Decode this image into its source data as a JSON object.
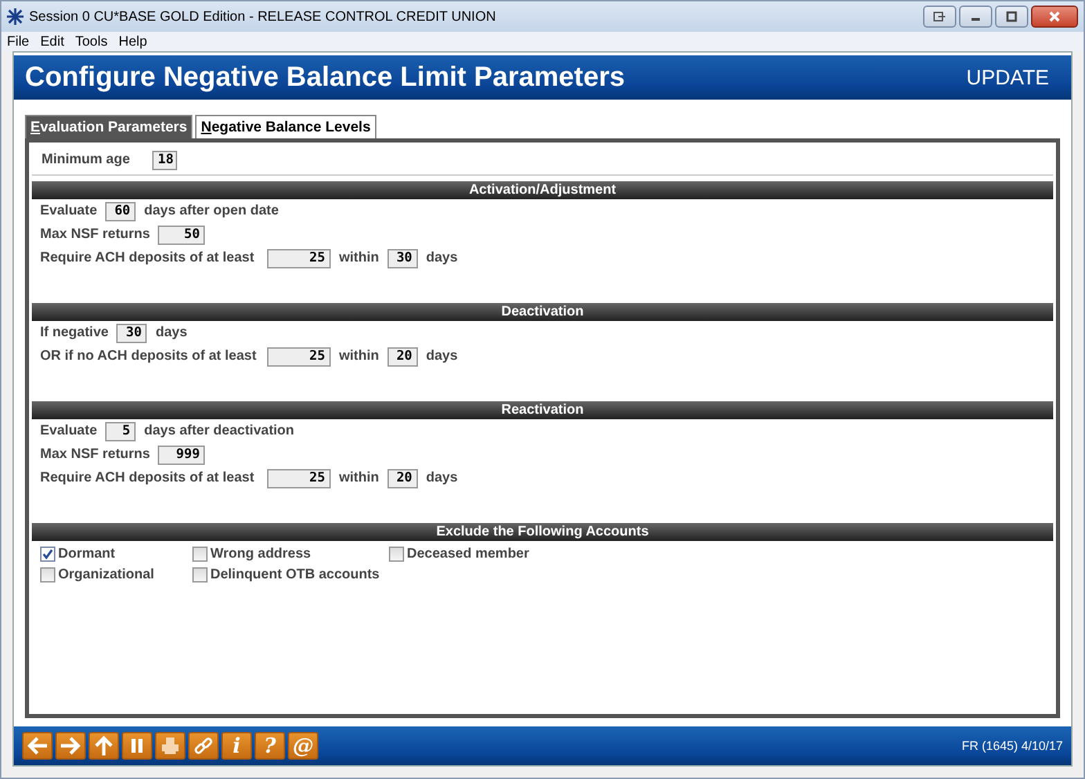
{
  "window": {
    "title": "Session 0 CU*BASE GOLD Edition - RELEASE CONTROL CREDIT UNION"
  },
  "menu": [
    "File",
    "Edit",
    "Tools",
    "Help"
  ],
  "header": {
    "title": "Configure Negative Balance Limit Parameters",
    "mode": "UPDATE"
  },
  "tabs": [
    {
      "label": "Evaluation Parameters",
      "selected": true
    },
    {
      "label": "Negative Balance Levels",
      "selected": false
    }
  ],
  "minimum_age": {
    "label": "Minimum age",
    "value": "18"
  },
  "sections": [
    {
      "title": "Activation/Adjustment",
      "rows": [
        {
          "parts": [
            {
              "kind": "text",
              "text": "Evaluate"
            },
            {
              "kind": "short_field",
              "value": "60"
            },
            {
              "kind": "text",
              "text": "days after open date"
            }
          ]
        },
        {
          "parts": [
            {
              "kind": "text",
              "text": "Max NSF returns"
            },
            {
              "kind": "mid_field",
              "value": "50"
            }
          ]
        },
        {
          "parts": [
            {
              "kind": "label",
              "text": "Require ACH deposits of at least"
            },
            {
              "kind": "long_field",
              "value": "25"
            },
            {
              "kind": "text",
              "text": "within"
            },
            {
              "kind": "short_field",
              "value": "30"
            },
            {
              "kind": "text",
              "text": "days"
            }
          ]
        }
      ]
    },
    {
      "title": "Deactivation",
      "rows": [
        {
          "parts": [
            {
              "kind": "text",
              "text": "If negative"
            },
            {
              "kind": "short_field",
              "value": "30"
            },
            {
              "kind": "text",
              "text": "days"
            }
          ]
        },
        {
          "parts": [
            {
              "kind": "label",
              "text": "OR if no ACH deposits of at least"
            },
            {
              "kind": "long_field",
              "value": "25"
            },
            {
              "kind": "text",
              "text": "within"
            },
            {
              "kind": "short_field",
              "value": "20"
            },
            {
              "kind": "text",
              "text": "days"
            }
          ]
        }
      ]
    },
    {
      "title": "Reactivation",
      "rows": [
        {
          "parts": [
            {
              "kind": "text",
              "text": "Evaluate"
            },
            {
              "kind": "short_field",
              "value": "5"
            },
            {
              "kind": "text",
              "text": "days after deactivation"
            }
          ]
        },
        {
          "parts": [
            {
              "kind": "text",
              "text": "Max NSF returns"
            },
            {
              "kind": "mid_field",
              "value": "999"
            }
          ]
        },
        {
          "parts": [
            {
              "kind": "label",
              "text": "Require ACH deposits of at least"
            },
            {
              "kind": "long_field",
              "value": "25"
            },
            {
              "kind": "text",
              "text": "within"
            },
            {
              "kind": "short_field",
              "value": "20"
            },
            {
              "kind": "text",
              "text": "days"
            }
          ]
        }
      ]
    }
  ],
  "exclusions": {
    "title": "Exclude the Following Accounts",
    "items": [
      {
        "label": "Dormant",
        "checked": true
      },
      {
        "label": "Wrong address",
        "checked": false
      },
      {
        "label": "Deceased member",
        "checked": false
      },
      {
        "label": "Organizational",
        "checked": false
      },
      {
        "label": "Delinquent OTB accounts",
        "checked": false
      }
    ]
  },
  "toolbar": [
    {
      "kind": "back"
    },
    {
      "kind": "forward"
    },
    {
      "kind": "up"
    },
    {
      "kind": "pause"
    },
    {
      "kind": "print"
    },
    {
      "kind": "link"
    },
    {
      "kind": "glyph",
      "text": "i"
    },
    {
      "kind": "glyph",
      "text": "?"
    },
    {
      "kind": "glyph",
      "text": "@"
    }
  ],
  "status": "FR (1645) 4/10/17"
}
